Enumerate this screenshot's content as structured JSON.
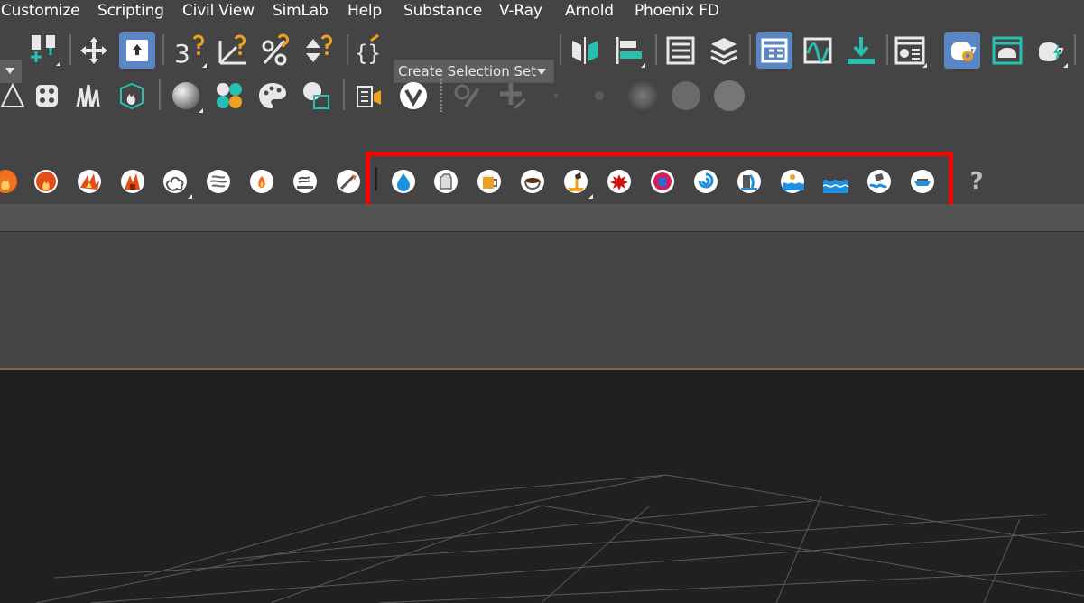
{
  "menu": {
    "items": [
      "Customize",
      "Scripting",
      "Civil View",
      "SimLab",
      "Help",
      "Substance",
      "V-Ray",
      "Arnold",
      "Phoenix FD"
    ]
  },
  "toolbar_main": {
    "selection_set_dropdown": "Create Selection Set",
    "snap_label": "3"
  },
  "phoenix_toolbar": {
    "help_label": "?",
    "highlighted": true
  },
  "colors": {
    "background": "#444444",
    "viewport": "#202020",
    "highlight_box": "#ff0000",
    "selected_button": "#5b86c4",
    "accent_orange": "#f0a020",
    "accent_teal": "#27c0b0"
  }
}
